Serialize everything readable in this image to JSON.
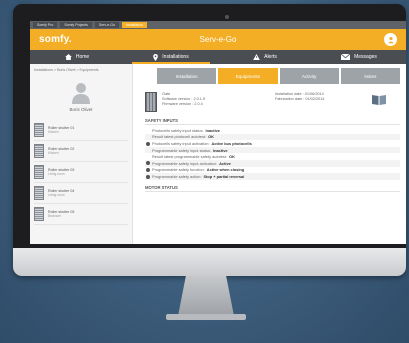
{
  "browser_tabs": [
    "Somfy Pro",
    "Somfy Projects",
    "Serv-e-Go",
    "Installation"
  ],
  "brand": {
    "logo": "somfy.",
    "app_title": "Serv-e-Go",
    "accent": "#f4ae26",
    "nav_bg": "#4a4d52"
  },
  "nav": [
    {
      "label": "Home",
      "icon": "home-icon"
    },
    {
      "label": "Installations",
      "icon": "location-pin-icon",
      "active": true
    },
    {
      "label": "Alerts",
      "icon": "warning-icon"
    },
    {
      "label": "Messages",
      "icon": "envelope-icon"
    }
  ],
  "breadcrumb": "Installations > Boris Olivet > Equipments",
  "owner": {
    "name": "Boris Olivet",
    "icon": "user-silhouette-icon"
  },
  "equipments": [
    {
      "name": "Roller shutter 01",
      "sub": "Kitchen"
    },
    {
      "name": "Roller shutter 02",
      "sub": "Kitchen"
    },
    {
      "name": "Roller shutter 03",
      "sub": "Living room"
    },
    {
      "name": "Roller shutter 04",
      "sub": "Living room"
    },
    {
      "name": "Roller shutter 05",
      "sub": "Bedroom"
    }
  ],
  "tabs": [
    {
      "label": "Installation"
    },
    {
      "label": "Equipments",
      "active": true
    },
    {
      "label": "Activity"
    },
    {
      "label": "Notes"
    }
  ],
  "device": {
    "line1": "Gate",
    "line2": "Software version : 2.0.1.5",
    "line3": "Firmware version : 2.0.4",
    "install_date": "Installation date : 01/06/2014",
    "fab_date": "Fabrication date : 01/02/2014"
  },
  "safety": {
    "title": "SAFETY INPUTS",
    "rows": [
      {
        "text": "Photocells safety input status:",
        "value": "Inactive",
        "info": false
      },
      {
        "text": "Result latest photocell autotest:",
        "value": "OK",
        "info": false
      },
      {
        "text": "Photocells safety input activation:",
        "value": "Active bus photocells",
        "info": true
      },
      {
        "text": "Programmable safety input status:",
        "value": "Inactive",
        "info": false
      },
      {
        "text": "Result latest programmable safety autotest:",
        "value": "OK",
        "info": false
      },
      {
        "text": "Programmable safety input activation:",
        "value": "Active",
        "info": true
      },
      {
        "text": "Programmable safety function:",
        "value": "Active when closing",
        "info": true
      },
      {
        "text": "Programmable safety action:",
        "value": "Stop + partial reversal",
        "info": true
      }
    ]
  },
  "motor": {
    "title": "MOTOR STATUS"
  }
}
